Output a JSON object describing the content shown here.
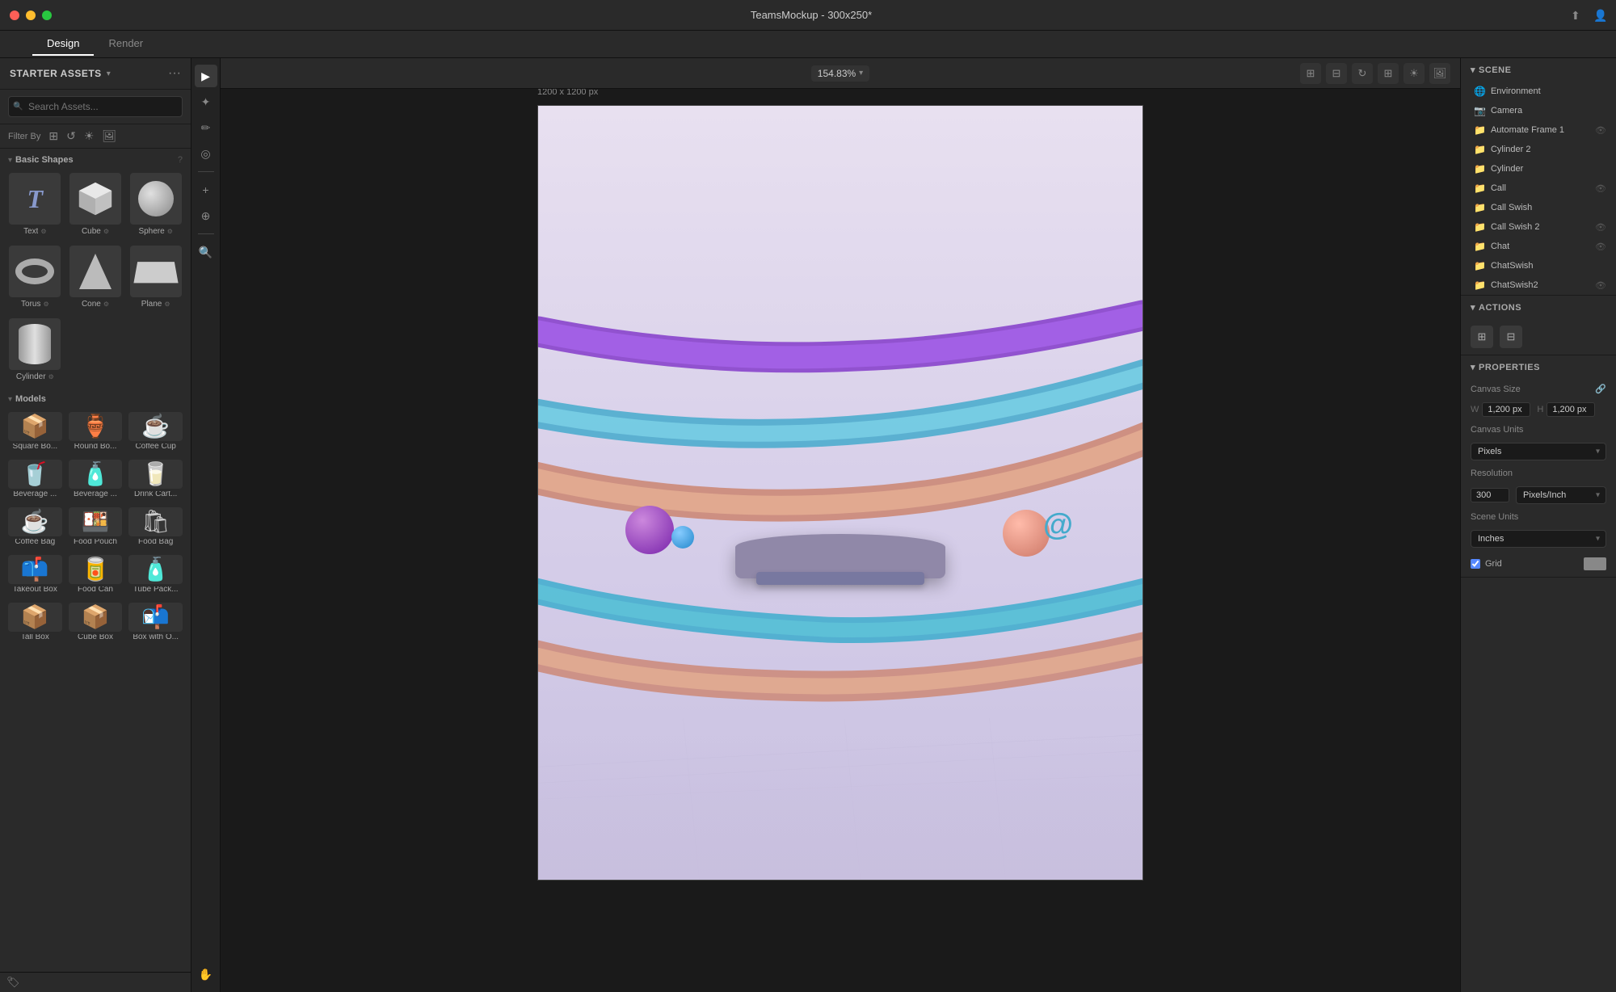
{
  "titlebar": {
    "title": "TeamsMockup - 300x250*",
    "upload_icon": "↑",
    "profile_icon": "👤"
  },
  "tabs": {
    "items": [
      "Design",
      "Render"
    ],
    "active": "Design"
  },
  "sidebar_left": {
    "header": "STARTER ASSETS",
    "chevron": "▾",
    "search_placeholder": "Search Assets...",
    "filter_label": "Filter By",
    "filter_icons": [
      "🔲",
      "🔄",
      "☀",
      "🖼"
    ],
    "sections": {
      "basic_shapes": {
        "title": "Basic Shapes",
        "items": [
          {
            "label": "Text",
            "icon": "T",
            "has_tune": true
          },
          {
            "label": "Cube",
            "icon": "cube",
            "has_tune": true
          },
          {
            "label": "Sphere",
            "icon": "sphere",
            "has_tune": true
          },
          {
            "label": "Torus",
            "icon": "torus",
            "has_tune": true
          },
          {
            "label": "Cone",
            "icon": "cone",
            "has_tune": true
          },
          {
            "label": "Plane",
            "icon": "plane",
            "has_tune": true
          },
          {
            "label": "Cylinder",
            "icon": "cylinder",
            "has_tune": true
          }
        ]
      },
      "models": {
        "title": "Models",
        "items": [
          {
            "label": "Square Bo...",
            "icon": "📦",
            "has_tune": false
          },
          {
            "label": "Round Bo...",
            "icon": "🏺",
            "has_tune": false
          },
          {
            "label": "Coffee Cup",
            "icon": "☕",
            "has_tune": false
          },
          {
            "label": "Beverage ...",
            "icon": "🥤",
            "has_tune": false
          },
          {
            "label": "Beverage ...",
            "icon": "🧴",
            "has_tune": false
          },
          {
            "label": "Drink Cart...",
            "icon": "🥛",
            "has_tune": false
          },
          {
            "label": "Coffee Bag",
            "icon": "☕",
            "has_tune": false
          },
          {
            "label": "Food Pouch",
            "icon": "🍱",
            "has_tune": false
          },
          {
            "label": "Food Bag",
            "icon": "🛍",
            "has_tune": false
          },
          {
            "label": "Takeout Box",
            "icon": "📫",
            "has_tune": false
          },
          {
            "label": "Food Can",
            "icon": "🥫",
            "has_tune": false
          },
          {
            "label": "Tube Pack...",
            "icon": "🧴",
            "has_tune": false
          },
          {
            "label": "Tall Box",
            "icon": "📦",
            "has_tune": false
          },
          {
            "label": "Cube Box",
            "icon": "📦",
            "has_tune": false
          },
          {
            "label": "Box with O...",
            "icon": "📬",
            "has_tune": false
          }
        ]
      }
    }
  },
  "toolbar": {
    "zoom": "154.83%",
    "canvas_size": "1200 x 1200 px",
    "icons": [
      "⊞",
      "⊟",
      "↻",
      "⊞",
      "☀",
      "🖼"
    ]
  },
  "canvas": {
    "size_label": "1200 x 1200 px"
  },
  "sidebar_right": {
    "scene_section": {
      "title": "SCENE",
      "items": [
        {
          "label": "Environment",
          "icon": "🌐",
          "has_eye": false
        },
        {
          "label": "Camera",
          "icon": "📷",
          "has_eye": false
        },
        {
          "label": "Automate Frame 1",
          "icon": "📁",
          "has_eye": true,
          "indent": 0
        },
        {
          "label": "Cylinder 2",
          "icon": "📁",
          "has_eye": false,
          "indent": 0
        },
        {
          "label": "Cylinder",
          "icon": "📁",
          "has_eye": false,
          "indent": 0
        },
        {
          "label": "Call",
          "icon": "📁",
          "has_eye": true,
          "indent": 0
        },
        {
          "label": "Call Swish",
          "icon": "📁",
          "has_eye": false,
          "indent": 0
        },
        {
          "label": "Call Swish 2",
          "icon": "📁",
          "has_eye": true,
          "indent": 0
        },
        {
          "label": "Chat",
          "icon": "📁",
          "has_eye": true,
          "indent": 0
        },
        {
          "label": "ChatSwish",
          "icon": "📁",
          "has_eye": false,
          "indent": 0
        },
        {
          "label": "ChatSwish2",
          "icon": "📁",
          "has_eye": true,
          "indent": 0
        }
      ]
    },
    "actions_section": {
      "title": "ACTIONS",
      "action1_icon": "⊞",
      "action2_icon": "⊟"
    },
    "properties_section": {
      "title": "PROPERTIES",
      "canvas_size_label": "Canvas Size",
      "link_icon": "🔗",
      "w_label": "W",
      "w_value": "1,200 px",
      "h_label": "H",
      "h_value": "1,200 px",
      "canvas_units_label": "Canvas Units",
      "canvas_units_value": "Pixels",
      "resolution_label": "Resolution",
      "resolution_value": "300",
      "resolution_unit_value": "Pixels/Inch",
      "scene_units_label": "Scene Units",
      "scene_units_value": "Inches",
      "grid_label": "Grid"
    }
  },
  "tools": {
    "left": [
      "▶",
      "✦",
      "✏",
      "◎",
      "+",
      "⊕",
      "🔍",
      "✋"
    ],
    "bottom": [
      "🏷"
    ]
  }
}
